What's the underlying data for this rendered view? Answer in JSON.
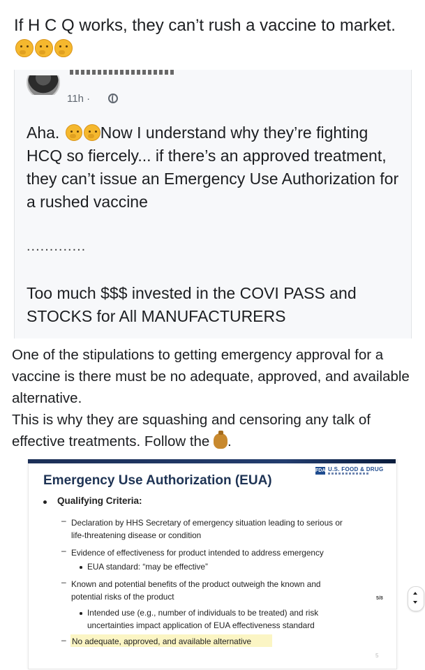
{
  "caption": {
    "text": "If H C Q works, they can’t rush a vaccine to market.",
    "emojis": [
      "thinking-face-icon",
      "thinking-face-icon",
      "thinking-face-icon"
    ]
  },
  "shared_post": {
    "timestamp": "11h ·",
    "privacy_icon": "globe-icon",
    "body_prefix": "Aha.",
    "body_main": "Now I understand why they’re fighting HCQ so fiercely... if there’s an approved treatment, they can’t issue an Emergency Use Authorization for a rushed vaccine",
    "separator": ".............",
    "cta": "Too much $$$ invested in the COVI PASS and STOCKS for All MANUFACTURERS"
  },
  "commentary": {
    "para1": "One of the stipulations to getting emergency approval for a vaccine is there must be no adequate, approved, and available alternative.",
    "para2": "This is why they are squashing and censoring any talk of effective treatments. Follow the",
    "end_icon": "money-bag-icon",
    "end_punct": "."
  },
  "slide": {
    "logo_badge": "FDA",
    "logo_text": "U.S. FOOD & DRUG",
    "title": "Emergency Use Authorization (EUA)",
    "qualifying_label": "Qualifying Criteria:",
    "criteria": [
      {
        "line1": "Declaration by HHS Secretary of emergency situation leading to serious or",
        "line2": "life-threatening disease or condition"
      },
      {
        "line1": "Evidence of effectiveness for product intended to address emergency",
        "line2": ""
      },
      {
        "line1": "Known and potential benefits of the product outweigh the known and",
        "line2": "potential risks of the product"
      },
      {
        "line1": "No adequate, approved, and available alternative",
        "line2": ""
      }
    ],
    "sub_points": [
      {
        "line1": "EUA standard: “may be effective”",
        "line2": ""
      },
      {
        "line1": "Intended use (e.g., number of individuals to be treated) and risk",
        "line2": "uncertainties impact application of EUA effectiveness standard"
      }
    ],
    "page_number": "5/8",
    "footer_mark": "5",
    "highlight_color": "#fbf5c4"
  },
  "scroll_control": {
    "icon": "up-down-chevron-icon"
  }
}
